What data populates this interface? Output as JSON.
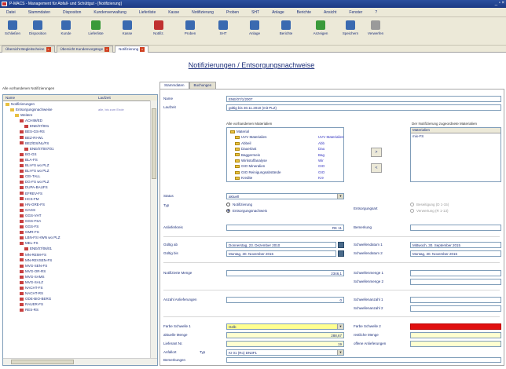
{
  "window": {
    "title": "P-MACS - Management für Abfall- und Schüttgut - [Notifizierung]"
  },
  "menu": [
    "Datei",
    "Stammdaten",
    "Dispositon",
    "Kundenverwaltung",
    "Lieferliste",
    "Kasse",
    "Notifizierung",
    "Proben",
    "SHT",
    "Anlage",
    "Berichte",
    "Ansicht",
    "Fenster",
    "?"
  ],
  "toolbar": [
    {
      "label": "Schließen",
      "icon": "close-door-icon",
      "color": "#3a6ab0"
    },
    {
      "label": "Disposition",
      "icon": "truck-icon",
      "color": "#3a6ab0"
    },
    {
      "label": "Kunde",
      "icon": "search-person-icon",
      "color": "#3a6ab0"
    },
    {
      "label": "Lieferliste",
      "icon": "list-icon",
      "color": "#3a9a3a"
    },
    {
      "label": "Kasse",
      "icon": "register-icon",
      "color": "#3a6ab0"
    },
    {
      "label": "Notifiz.",
      "icon": "document-icon",
      "color": "#c03030"
    },
    {
      "label": "Proben",
      "icon": "flask-icon",
      "color": "#3a6ab0"
    },
    {
      "label": "SHT",
      "icon": "book-icon",
      "color": "#3a6ab0"
    },
    {
      "label": "Anlage",
      "icon": "factory-icon",
      "color": "#3a6ab0"
    },
    {
      "label": "Berichte",
      "icon": "report-icon",
      "color": "#3a6ab0"
    },
    {
      "label": "Anzeigen",
      "icon": "chart-icon",
      "color": "#3a9a3a"
    },
    {
      "label": "Speichern",
      "icon": "save-icon",
      "color": "#3a6ab0"
    },
    {
      "label": "Verwerfen",
      "icon": "discard-icon",
      "color": "#9a9a9a"
    }
  ],
  "doc_tabs": [
    {
      "label": "Übersicht Begleitscheine"
    },
    {
      "label": "Übersicht Kundenvorgänge"
    },
    {
      "label": "Notifizierung"
    }
  ],
  "page": {
    "heading": "Notifizierungen / Entsorgungsnachweise"
  },
  "tree": {
    "caption": "Alle vorhandenen Notifizierungen",
    "col_name": "Name",
    "col_laufzeit": "Laufzeit",
    "rows": [
      {
        "name": "Notifizierungen",
        "laufzeit": "",
        "level": 0
      },
      {
        "name": "Entsorgungsnachweise",
        "laufzeit": "alle, bis zum Ende",
        "level": 1
      },
      {
        "name": "Weitere",
        "laufzeit": "",
        "level": 2
      },
      {
        "name": "ACHIM/ED",
        "laufzeit": "",
        "level": 3
      },
      {
        "name": "ENE/07/001",
        "laufzeit": "",
        "level": 4
      },
      {
        "name": "BES-GS-RS",
        "laufzeit": "",
        "level": 3
      },
      {
        "name": "BEZ-RI-WL",
        "laufzeit": "",
        "level": 3
      },
      {
        "name": "BEZ/DS/NL/FS",
        "laufzeit": "",
        "level": 3
      },
      {
        "name": "ENE/07/007/01",
        "laufzeit": "",
        "level": 4
      },
      {
        "name": "BG-GS",
        "laufzeit": "",
        "level": 3
      },
      {
        "name": "BLA-FS",
        "laufzeit": "",
        "level": 3
      },
      {
        "name": "BLI-FS wo PLZ",
        "laufzeit": "",
        "level": 3
      },
      {
        "name": "BLI-FS wo PLZ",
        "laufzeit": "",
        "level": 3
      },
      {
        "name": "CEI-TALL",
        "laufzeit": "",
        "level": 3
      },
      {
        "name": "DG-FS wo PLZ",
        "laufzeit": "",
        "level": 3
      },
      {
        "name": "DUPA-BAUFS",
        "laufzeit": "",
        "level": 3
      },
      {
        "name": "EFREV-FS",
        "laufzeit": "",
        "level": 3
      },
      {
        "name": "HCS-FM",
        "laufzeit": "",
        "level": 3
      },
      {
        "name": "HN-GRE-FS",
        "laufzeit": "",
        "level": 3
      },
      {
        "name": "GAGS",
        "laufzeit": "",
        "level": 3
      },
      {
        "name": "GGS-VHT",
        "laufzeit": "",
        "level": 3
      },
      {
        "name": "GGS-FSA",
        "laufzeit": "",
        "level": 3
      },
      {
        "name": "GGS-FS",
        "laufzeit": "",
        "level": 3
      },
      {
        "name": "GMR-FS",
        "laufzeit": "",
        "level": 3
      },
      {
        "name": "LBN-FS HWN wo PLZ",
        "laufzeit": "",
        "level": 3
      },
      {
        "name": "MEL-FS",
        "laufzeit": "",
        "level": 3
      },
      {
        "name": "ENE/07/06/01",
        "laufzeit": "",
        "level": 4
      },
      {
        "name": "MN-REIM-FS",
        "laufzeit": "",
        "level": 3
      },
      {
        "name": "MN-REVSEN-FS",
        "laufzeit": "",
        "level": 3
      },
      {
        "name": "MVG-SEN-FS",
        "laufzeit": "",
        "level": 3
      },
      {
        "name": "MVG-OR-RS",
        "laufzeit": "",
        "level": 3
      },
      {
        "name": "MVG-SAMS",
        "laufzeit": "",
        "level": 3
      },
      {
        "name": "MVG-SALZ",
        "laufzeit": "",
        "level": 3
      },
      {
        "name": "NACHT-FS",
        "laufzeit": "",
        "level": 3
      },
      {
        "name": "NACHT-RS",
        "laufzeit": "",
        "level": 3
      },
      {
        "name": "ODE-BIO-BERG",
        "laufzeit": "",
        "level": 3
      },
      {
        "name": "RAUER-FS",
        "laufzeit": "",
        "level": 3
      },
      {
        "name": "RES-RS",
        "laufzeit": "",
        "level": 3
      }
    ]
  },
  "form_tabs": [
    {
      "label": "Stammdaten"
    },
    {
      "label": "Buchungen"
    }
  ],
  "form": {
    "name_label": "Name",
    "name_value": "ENE/07/1/2007",
    "laufzeit_label": "Laufzeit",
    "laufzeit_value": "gültig bis 30.11.2010 (mit PLZ)",
    "avail_caption": "Alle vorhandenen Materialien",
    "assigned_caption": "Der Notifizierung zugeordnete Materialien",
    "assigned_header": "Materialien",
    "assigned_item": "mix-FS",
    "materials": [
      {
        "name": "Material",
        "ab": ""
      },
      {
        "name": "UVV Materialien",
        "ab": "UVV Materialien"
      },
      {
        "name": "Abbeil",
        "ab": "Abb"
      },
      {
        "name": "Dauerlast",
        "ab": "Dau"
      },
      {
        "name": "Baggermeis",
        "ab": "Bag"
      },
      {
        "name": "Wirkstoffanalyse",
        "ab": "Wir"
      },
      {
        "name": "GIO Mineralien",
        "ab": "GIO"
      },
      {
        "name": "GIO Reinigungsabstände",
        "ab": "GIO"
      },
      {
        "name": "Kredite",
        "ab": "Kre"
      }
    ],
    "add_btn": ">",
    "remove_btn": "<",
    "status_label": "Status",
    "status_value": "aktuell",
    "typ_label": "Typ",
    "typ_options": [
      "Notifizierung",
      "Entsorgungsnachweis"
    ],
    "typ_selected": 1,
    "entsorgung_label": "Entsorgungsart",
    "entsorgung_options": [
      "Beseitigung (D 1-15)",
      "Verwertung (R 1-13)"
    ],
    "anlieferkreis_label": "Anlieferkreis",
    "anlieferkreis_value": "RK 11",
    "bemerkung_label": "Bemerkung",
    "bemerkung_value": "",
    "gueltig_ab_label": "Gültig ab",
    "gueltig_ab_value": "Donnerstag, 23. Dezember 2010",
    "gueltig_bis_label": "Gültig bis",
    "gueltig_bis_value": "Montag, 30. November 2015",
    "schwelle1_label": "Schwellendatum 1",
    "schwelle1_value": "Mittwoch, 30. September 2015",
    "schwelle2_label": "Schwellendatum 2",
    "schwelle2_value": "Montag, 30. November 2015",
    "menge_label": "Notifizierte Menge",
    "menge_value": "2346,1",
    "smenge1_label": "Schwellenmenge 1",
    "smenge1_value": "",
    "smenge2_label": "Schwellenmenge 2",
    "smenge2_value": "",
    "anzahl_label": "Anzahl Anlieferungen",
    "anzahl_value": "0",
    "sanzahl1_label": "Schwellenanzahl 1",
    "sanzahl1_value": "",
    "sanzahl2_label": "Schwellenanzahl 2",
    "sanzahl2_value": "",
    "farbe1_label": "Farbe Schwelle 1",
    "farbe1_value": "Gelb",
    "farbe1_color": "#ffff50",
    "farbe2_label": "Farbe Schwelle 2",
    "farbe2_color": "#e01010",
    "aktmenge_label": "aktuelle Menge",
    "aktmenge_value": "288,67",
    "restmenge_label": "restliche Menge",
    "restmenge_value": "",
    "lieferant_label": "Lieferant Nr.",
    "lieferant_value": "19",
    "offen_label": "offene Anlieferungen",
    "offen_value": "",
    "anfallort_label": "Anfallort",
    "anfallort_value": "",
    "typ2_label": "Typ",
    "typ2_value": "KI 01 (Ro) DN3F1",
    "bemerk2_label": "Bemerkungen",
    "bemerk2_value": ""
  }
}
